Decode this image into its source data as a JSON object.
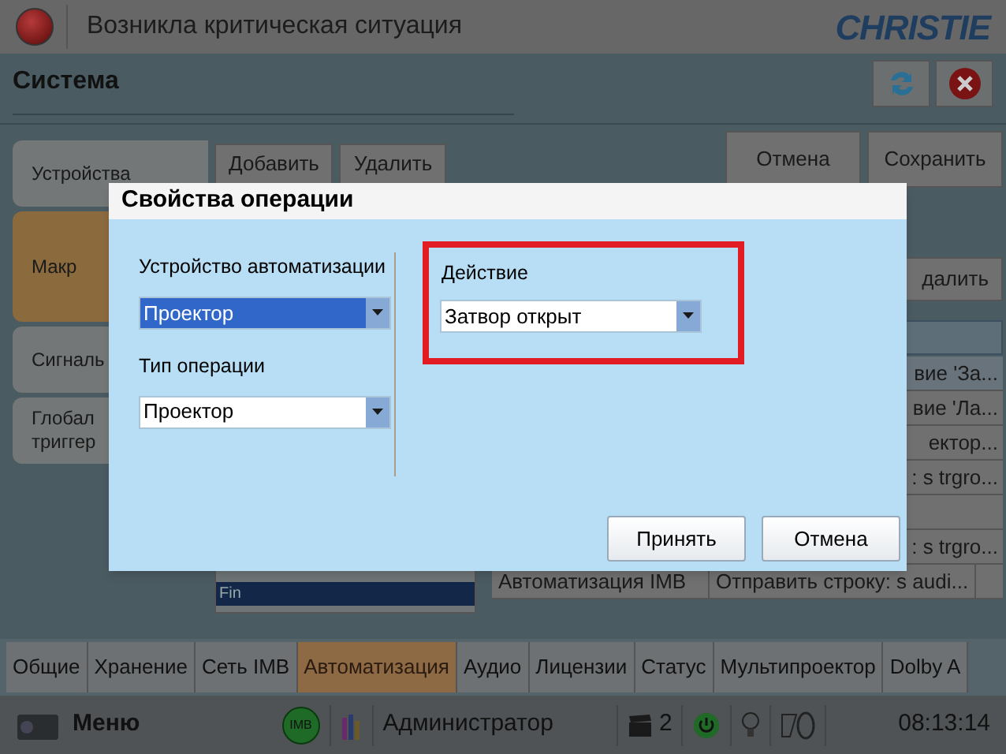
{
  "top_bar": {
    "title": "Возникла критическая ситуация",
    "logo": "CHRISTIE"
  },
  "header": {
    "title": "Система"
  },
  "side_tabs": [
    {
      "label": "Устройства",
      "selected": false
    },
    {
      "label": "Макр",
      "selected": true
    },
    {
      "label": "Сигналь",
      "selected": false
    },
    {
      "label": "Глобал\nтриггер",
      "selected": false
    }
  ],
  "toolbar_buttons": [
    "Добавить",
    "Удалить"
  ],
  "right_buttons": [
    "Отмена",
    "Сохранить"
  ],
  "delete_button": "далить",
  "list": [
    {
      "label": "Fin",
      "selected": true
    }
  ],
  "table_rows": [
    {
      "cells": [
        "вие 'За..."
      ],
      "selected": true
    },
    {
      "cells": [
        "вие 'Ла..."
      ],
      "selected": false
    },
    {
      "cells": [
        "ектор..."
      ],
      "selected": false
    },
    {
      "cells": [
        ": s trgro..."
      ],
      "selected": false
    },
    {
      "cells": [],
      "selected": false
    },
    {
      "cells": [
        ": s trgro..."
      ],
      "selected": false
    },
    {
      "cells": [
        "Автоматизация IMB",
        "Отправить строку: s audi..."
      ],
      "selected": false
    }
  ],
  "dialog": {
    "title": "Свойства операции",
    "device": {
      "label": "Устройство автоматизации",
      "value": "Проектор",
      "highlighted": true
    },
    "operation_type": {
      "label": "Тип операции",
      "value": "Проектор",
      "highlighted": false
    },
    "action": {
      "label": "Действие",
      "value": "Затвор открыт",
      "highlighted": false
    },
    "buttons": [
      "Принять",
      "Отмена"
    ]
  },
  "bottom_tabs": [
    {
      "label": "Общие",
      "selected": false
    },
    {
      "label": "Хранение",
      "selected": false
    },
    {
      "label": "Сеть IMB",
      "selected": false
    },
    {
      "label": "Автоматизация",
      "selected": true
    },
    {
      "label": "Аудио",
      "selected": false
    },
    {
      "label": "Лицензии",
      "selected": false
    },
    {
      "label": "Статус",
      "selected": false
    },
    {
      "label": "Мультипроектор",
      "selected": false
    },
    {
      "label": "Dolby A",
      "selected": false
    }
  ],
  "taskbar": {
    "menu": "Меню",
    "imb_badge": "IMB",
    "user": "Администратор",
    "count": "2",
    "time": "08:13:14"
  }
}
